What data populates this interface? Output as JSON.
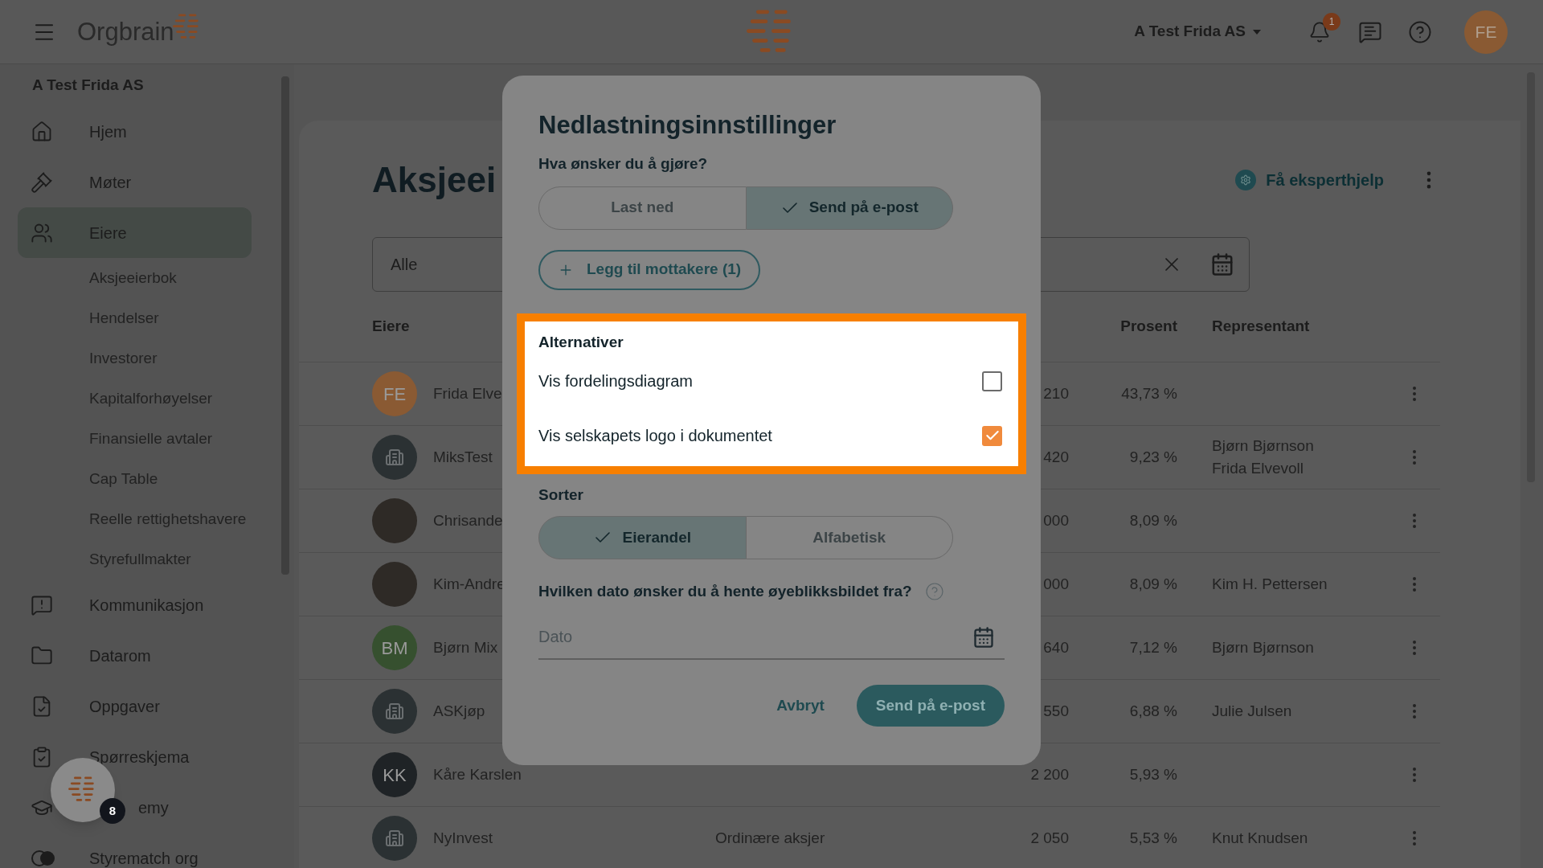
{
  "topbar": {
    "logo_text": "Orgbrain",
    "company": "A Test Frida AS",
    "notifications": "1",
    "avatar": "FE"
  },
  "sidebar": {
    "company": "A Test Frida AS",
    "items": [
      {
        "label": "Hjem",
        "kind": "nav",
        "selected": false
      },
      {
        "label": "Møter",
        "kind": "nav",
        "selected": false
      },
      {
        "label": "Eiere",
        "kind": "nav",
        "selected": true,
        "children": [
          {
            "label": "Aksjeeierbok",
            "selected": false
          },
          {
            "label": "Hendelser",
            "selected": false
          },
          {
            "label": "Investorer",
            "selected": false
          },
          {
            "label": "Kapitalforhøyelser",
            "selected": false
          },
          {
            "label": "Finansielle avtaler",
            "selected": false
          },
          {
            "label": "Cap Table",
            "selected": false
          },
          {
            "label": "Reelle rettighetshavere",
            "selected": false
          },
          {
            "label": "Styrefullmakter",
            "selected": false
          }
        ]
      },
      {
        "label": "Kommunikasjon",
        "kind": "nav",
        "selected": false
      },
      {
        "label": "Datarom",
        "kind": "nav",
        "selected": false
      },
      {
        "label": "Oppgaver",
        "kind": "nav",
        "selected": false
      },
      {
        "label": "Spørreskjema",
        "kind": "nav",
        "selected": false
      },
      {
        "label": "emy",
        "kind": "under_fab",
        "selected": false
      },
      {
        "label": "Styrematch org",
        "kind": "nav",
        "selected": false
      }
    ]
  },
  "fab": {
    "badge": "8"
  },
  "page": {
    "title": "Aksjeei",
    "help_link": "Få eksperthjelp",
    "filter": {
      "value": "Alle"
    },
    "columns": {
      "owner": "Eiere",
      "percent": "Prosent",
      "representative": "Representant"
    },
    "rows": [
      {
        "avatar": {
          "kind": "initials",
          "initials": "FE",
          "color": "#8a5a33"
        },
        "name": "Frida Elve",
        "shares": "210",
        "percent": "43,73 %",
        "representatives": []
      },
      {
        "avatar": {
          "kind": "company"
        },
        "name": "MiksTest",
        "shares": "420",
        "percent": "9,23 %",
        "representatives": [
          "Bjørn Bjørnson",
          "Frida Elvevoll"
        ]
      },
      {
        "avatar": {
          "kind": "photo"
        },
        "name": "Chrisande",
        "shares": "000",
        "percent": "8,09 %",
        "representatives": []
      },
      {
        "avatar": {
          "kind": "photo"
        },
        "name": "Kim-Andre",
        "shares": "000",
        "percent": "8,09 %",
        "representatives": [
          "Kim H. Pettersen"
        ]
      },
      {
        "avatar": {
          "kind": "initials",
          "initials": "BM",
          "color": "#36502f"
        },
        "name": "Bjørn Mix",
        "shares": "640",
        "percent": "7,12 %",
        "representatives": [
          "Bjørn Bjørnson"
        ]
      },
      {
        "avatar": {
          "kind": "company"
        },
        "name": "ASKjøp",
        "shares": "550",
        "percent": "6,88 %",
        "representatives": [
          "Julie Julsen"
        ]
      },
      {
        "avatar": {
          "kind": "initials",
          "initials": "KK",
          "color": "#1f2326"
        },
        "name": "Kåre Karslen",
        "shares": "2 200",
        "percent": "5,93 %",
        "representatives": []
      },
      {
        "avatar": {
          "kind": "company"
        },
        "name": "NyInvest",
        "type": "Ordinære aksjer",
        "shares": "2 050",
        "percent": "5,53 %",
        "representatives": [
          "Knut Knudsen"
        ]
      }
    ]
  },
  "dialog": {
    "title": "Nedlastningsinnstillinger",
    "question": "Hva ønsker du å gjøre?",
    "actions": [
      {
        "label": "Last ned",
        "selected": false
      },
      {
        "label": "Send på e-post",
        "selected": true
      }
    ],
    "add_recipients": "Legg til mottakere (1)",
    "options_title": "Alternativer",
    "options": [
      {
        "label": "Vis fordelingsdiagram",
        "checked": false
      },
      {
        "label": "Vis selskapets logo i dokumentet",
        "checked": true
      }
    ],
    "sort_title": "Sorter",
    "sort_options": [
      {
        "label": "Eierandel",
        "selected": true
      },
      {
        "label": "Alfabetisk",
        "selected": false
      }
    ],
    "date_question": "Hvilken dato ønsker du å hente øyeblikksbildet fra?",
    "date_field": {
      "placeholder": "Dato"
    },
    "cancel": "Avbryt",
    "submit": "Send på e-post"
  }
}
